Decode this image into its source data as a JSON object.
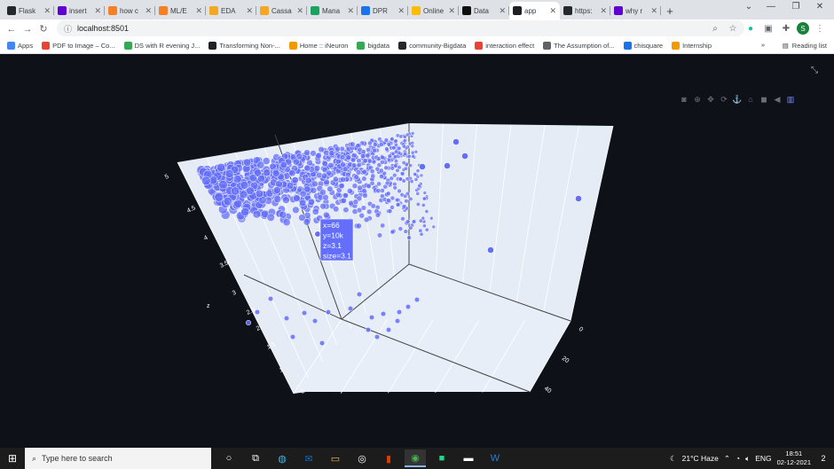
{
  "browser": {
    "tabs": [
      {
        "title": "Flask",
        "color": "#24292f"
      },
      {
        "title": "insert",
        "color": "#6001d2"
      },
      {
        "title": "how c",
        "color": "#f48024"
      },
      {
        "title": "ML/E",
        "color": "#f48024"
      },
      {
        "title": "EDA",
        "color": "#f5a623"
      },
      {
        "title": "Cassa",
        "color": "#f5a623"
      },
      {
        "title": "Mana",
        "color": "#1aa260"
      },
      {
        "title": "DPR",
        "color": "#1a73e8"
      },
      {
        "title": "Online",
        "color": "#fbbc04"
      },
      {
        "title": "Data",
        "color": "#0f0f0f"
      },
      {
        "title": "app",
        "color": "#1f1f1f",
        "active": true
      },
      {
        "title": "https:",
        "color": "#24292f"
      },
      {
        "title": "why r",
        "color": "#6001d2"
      }
    ],
    "new_tab_label": "+",
    "url": "localhost:8501",
    "profile_initial": "S",
    "bookmarks": [
      {
        "label": "Apps",
        "color": "#4285f4"
      },
      {
        "label": "PDF to Image – Co...",
        "color": "#ea4335"
      },
      {
        "label": "DS with R evening J...",
        "color": "#34a853"
      },
      {
        "label": "Transforming Non-...",
        "color": "#202124"
      },
      {
        "label": "Home :: iNeuron",
        "color": "#f29900"
      },
      {
        "label": "bigdata",
        "color": "#34a853"
      },
      {
        "label": "community-Bigdata",
        "color": "#24292f"
      },
      {
        "label": "interaction effect",
        "color": "#ea4335"
      },
      {
        "label": "The Assumption of...",
        "color": "#5f6368"
      },
      {
        "label": "chisquare",
        "color": "#1a73e8"
      },
      {
        "label": "Internship",
        "color": "#f29900"
      }
    ],
    "bookmarks_more": "»",
    "reading_list": "Reading list"
  },
  "modebar_icons": [
    "camera-icon",
    "zoom-icon",
    "pan-icon",
    "orbit-icon",
    "turntable-icon",
    "home-icon",
    "video-camera-icon",
    "spikelines-icon",
    "plotly-logo-icon"
  ],
  "colors": {
    "marker": "#636efa",
    "scene_bg": "#e5ecf6",
    "page_bg": "#0e1117"
  },
  "chart_data": {
    "type": "scatter",
    "mode": "3d",
    "title": "",
    "axes": {
      "z": {
        "label": "z",
        "ticks": [
          "1",
          "1.5",
          "2",
          "2.5",
          "3",
          "3.5",
          "4",
          "4.5",
          "5"
        ],
        "range": [
          1,
          5
        ]
      },
      "x": {
        "ticks": [
          "0",
          "20",
          "40"
        ]
      },
      "y": {
        "ticks": [
          "0"
        ]
      }
    },
    "hover": {
      "x": "66",
      "y": "10k",
      "z": "3.1",
      "size": "3.1",
      "lines": [
        "x=66",
        "y=10k",
        "z=3.1",
        "size=3.1"
      ]
    },
    "outliers": [
      {
        "z": 4.9
      },
      {
        "z": 4.8
      },
      {
        "z": 4.7
      },
      {
        "z": 4.2
      },
      {
        "z": 3.2
      }
    ],
    "grid": true
  },
  "taskbar": {
    "search_placeholder": "Type here to search",
    "weather": "21°C  Haze",
    "language": "ENG",
    "time": "18:51",
    "date": "02-12-2021",
    "notifications": "2"
  }
}
